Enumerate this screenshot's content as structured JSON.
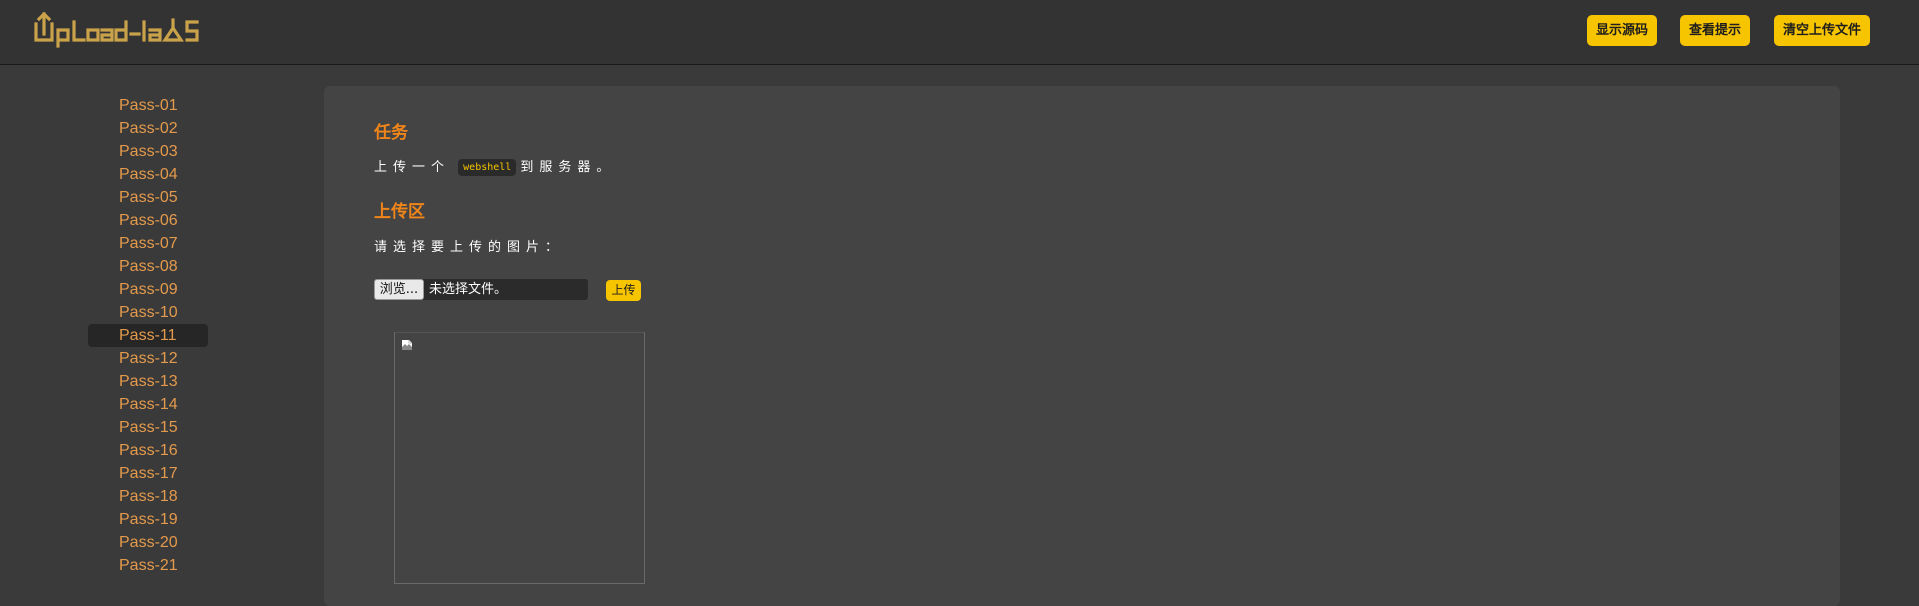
{
  "header": {
    "logo_text": "UpLoad-labS",
    "buttons": [
      "显示源码",
      "查看提示",
      "清空上传文件"
    ]
  },
  "sidebar": {
    "items": [
      "Pass-01",
      "Pass-02",
      "Pass-03",
      "Pass-04",
      "Pass-05",
      "Pass-06",
      "Pass-07",
      "Pass-08",
      "Pass-09",
      "Pass-10",
      "Pass-11",
      "Pass-12",
      "Pass-13",
      "Pass-14",
      "Pass-15",
      "Pass-16",
      "Pass-17",
      "Pass-18",
      "Pass-19",
      "Pass-20",
      "Pass-21"
    ],
    "active": "Pass-11"
  },
  "main": {
    "task_heading": "任务",
    "task_prefix": "上传一个",
    "task_code": "webshell",
    "task_suffix": "到服务器。",
    "upload_heading": "上传区",
    "select_prompt": "请选择要上传的图片：",
    "browse_label": "浏览...",
    "no_file_text": "未选择文件。",
    "upload_label": "上传"
  },
  "colors": {
    "accent": "#f7c400",
    "link": "#e49a4c",
    "heading": "#f08519",
    "background": "#3a3a3a",
    "panel": "#444444"
  }
}
